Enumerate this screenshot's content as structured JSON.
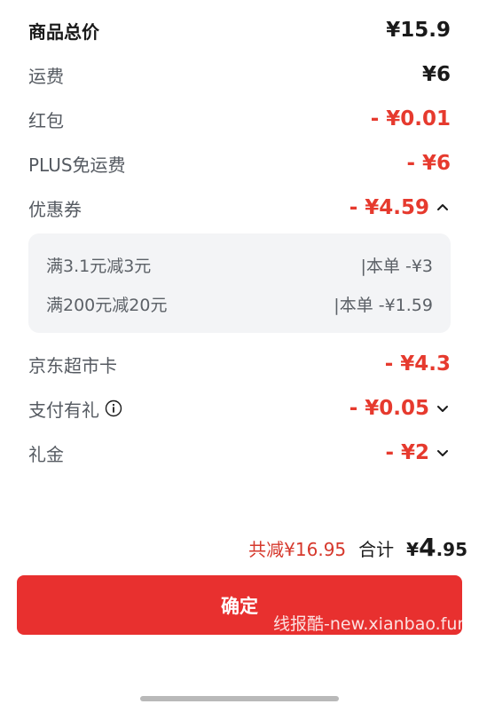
{
  "rows": [
    {
      "label": "商品总价",
      "amount": "¥15.9"
    },
    {
      "label": "运费",
      "amount": "¥6"
    },
    {
      "label": "红包",
      "amount": "- ¥0.01"
    },
    {
      "label": "PLUS免运费",
      "amount": "- ¥6"
    },
    {
      "label": "优惠券",
      "amount": "- ¥4.59"
    },
    {
      "label": "京东超市卡",
      "amount": "- ¥4.3"
    },
    {
      "label": "支付有礼",
      "amount": "- ¥0.05"
    },
    {
      "label": "礼金",
      "amount": "- ¥2"
    }
  ],
  "coupons": [
    {
      "rule": "满3.1元减3元",
      "deduct": "|本单 -¥3"
    },
    {
      "rule": "满200元减20元",
      "deduct": "|本单 -¥1.59"
    }
  ],
  "summary": {
    "saved": "共减¥16.95",
    "total_label": "合计",
    "total_yen": "¥",
    "total_int": "4",
    "total_dec": ".95"
  },
  "confirm_label": "确定",
  "watermark": "线报酷-new.xianbao.fun",
  "colors": {
    "accent": "#e8302f",
    "discount": "#e63a2e",
    "panel": "#f3f4f6"
  },
  "icons": {
    "coupon_toggle": "chevron-up-icon",
    "pay_gift_info": "info-icon",
    "pay_gift_toggle": "chevron-down-icon",
    "gift_toggle": "chevron-down-icon"
  }
}
